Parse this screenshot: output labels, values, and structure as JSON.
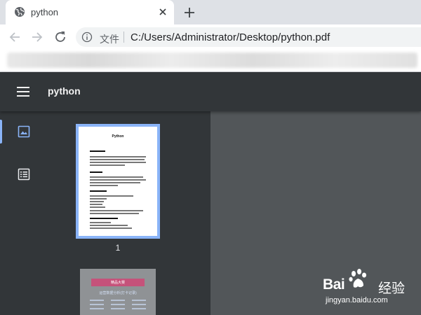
{
  "browser": {
    "tab": {
      "title": "python",
      "favicon": "globe-icon",
      "close_icon": "close-icon"
    },
    "new_tab_icon": "plus-icon",
    "toolbar": {
      "back_icon": "arrow-left-icon",
      "forward_icon": "arrow-right-icon",
      "reload_icon": "reload-icon",
      "info_icon": "info-icon",
      "scheme_label": "文件",
      "url": "C:/Users/Administrator/Desktop/python.pdf"
    }
  },
  "pdf_viewer": {
    "title": "python",
    "menu_icon": "hamburger-menu-icon",
    "sidebar": {
      "thumbnails_icon": "image-icon",
      "outline_icon": "list-icon",
      "active": "thumbnails",
      "pages": [
        {
          "number": "1",
          "selected": true
        },
        {
          "number": "",
          "selected": false
        }
      ]
    },
    "thumbnail_page1": {
      "title": "Python"
    },
    "thumbnail_page2": {
      "header": "精品大赛",
      "title": "运营数据分析(打卡记录)"
    }
  },
  "watermark": {
    "brand": "Bai",
    "brand_suffix": "经验",
    "url": "jingyan.baidu.com"
  },
  "colors": {
    "pdf_toolbar": "#323639",
    "pdf_background": "#525659",
    "selection_accent": "#8ab4f8",
    "tab_strip": "#dee1e6"
  }
}
